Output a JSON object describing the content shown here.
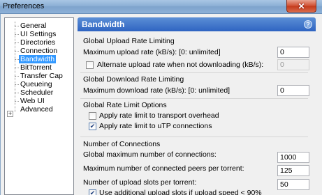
{
  "window": {
    "title": "Preferences",
    "close_label": "✕"
  },
  "sidebar": {
    "items": [
      {
        "label": "General"
      },
      {
        "label": "UI Settings"
      },
      {
        "label": "Directories"
      },
      {
        "label": "Connection"
      },
      {
        "label": "Bandwidth",
        "selected": true
      },
      {
        "label": "BitTorrent"
      },
      {
        "label": "Transfer Cap"
      },
      {
        "label": "Queueing"
      },
      {
        "label": "Scheduler"
      },
      {
        "label": "Web UI"
      },
      {
        "label": "Advanced",
        "expandable": true
      }
    ],
    "expander_symbol": "+"
  },
  "panel": {
    "title": "Bandwidth",
    "help_symbol": "?",
    "upload_group": {
      "heading": "Global Upload Rate Limiting",
      "max_upload_label": "Maximum upload rate (kB/s): [0: unlimited]",
      "max_upload_value": "0",
      "alt_upload_label": "Alternate upload rate when not downloading (kB/s):",
      "alt_upload_checked": false,
      "alt_upload_value": "0"
    },
    "download_group": {
      "heading": "Global Download Rate Limiting",
      "max_download_label": "Maximum download rate (kB/s): [0: unlimited]",
      "max_download_value": "0"
    },
    "options_group": {
      "heading": "Global Rate Limit Options",
      "transport_overhead_label": "Apply rate limit to transport overhead",
      "transport_overhead_checked": false,
      "utp_label": "Apply rate limit to uTP connections",
      "utp_checked": true
    },
    "connections_group": {
      "heading": "Number of Connections",
      "global_max_label": "Global maximum number of connections:",
      "global_max_value": "1000",
      "peers_per_torrent_label": "Maximum number of connected peers per torrent:",
      "peers_per_torrent_value": "125",
      "upload_slots_label": "Number of upload slots per torrent:",
      "upload_slots_value": "50",
      "extra_slots_label": "Use additional upload slots if upload speed < 90%",
      "extra_slots_checked": true
    }
  },
  "colors": {
    "header_blue": "#2f64c2",
    "selection_blue": "#3399ff",
    "close_red": "#c43c1d"
  }
}
